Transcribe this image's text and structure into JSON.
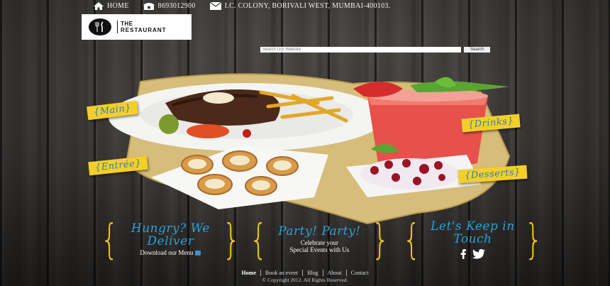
{
  "topbar": {
    "home_label": "HOME",
    "phone": "8693012900",
    "address": "I.C. COLONY, BORIVALI WEST, MUMBAI-400103."
  },
  "logo": {
    "line1": "THE",
    "line2": "RESTAURANT"
  },
  "search": {
    "placeholder": "Search Our Website",
    "button_label": "Search"
  },
  "menu_tags": {
    "main": "{Main}",
    "drinks": "{Drinks}",
    "entree": "{Entrée}",
    "desserts": "{Desserts}"
  },
  "promos": {
    "deliver": {
      "title": "Hungry? We Deliver",
      "link": "Download our Menu"
    },
    "party": {
      "title": "Party! Party!",
      "sub1": "Celebrate your",
      "sub2": "Special Events with Us"
    },
    "touch": {
      "title": "Let's Keep in Touch"
    }
  },
  "footer": {
    "links": [
      "Home",
      "Book an event",
      "Blog",
      "About",
      "Contact"
    ],
    "copyright": "© Copyright 2012. All Rights Reserved."
  },
  "colors": {
    "accent_yellow": "#f4cf2a",
    "accent_blue": "#2a9fd8",
    "wood": "#3a3836"
  }
}
